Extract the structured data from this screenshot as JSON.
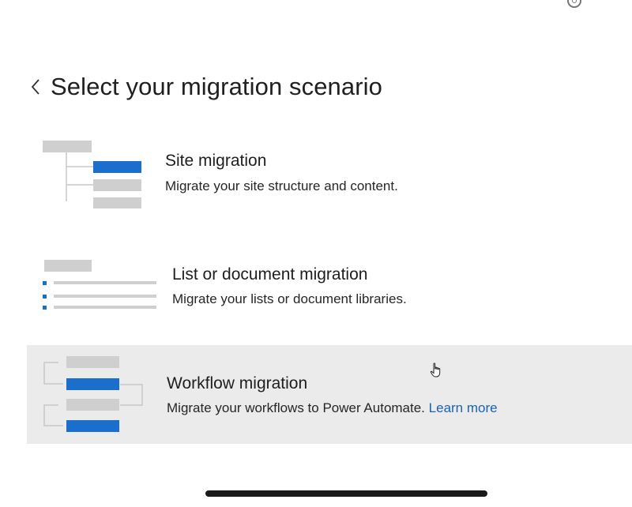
{
  "header": {
    "title": "Select your migration scenario"
  },
  "scenarios": [
    {
      "title": "Site migration",
      "description": "Migrate your site structure and content."
    },
    {
      "title": "List or document migration",
      "description": "Migrate your lists or document libraries."
    },
    {
      "title": "Workflow migration",
      "description": "Migrate your workflows to Power Automate.",
      "link": "Learn more"
    }
  ],
  "colors": {
    "accent": "#1a6fcc",
    "illustration_gray": "#cfcfcf",
    "link": "#1a62b3",
    "hover_background": "#ebebeb"
  }
}
